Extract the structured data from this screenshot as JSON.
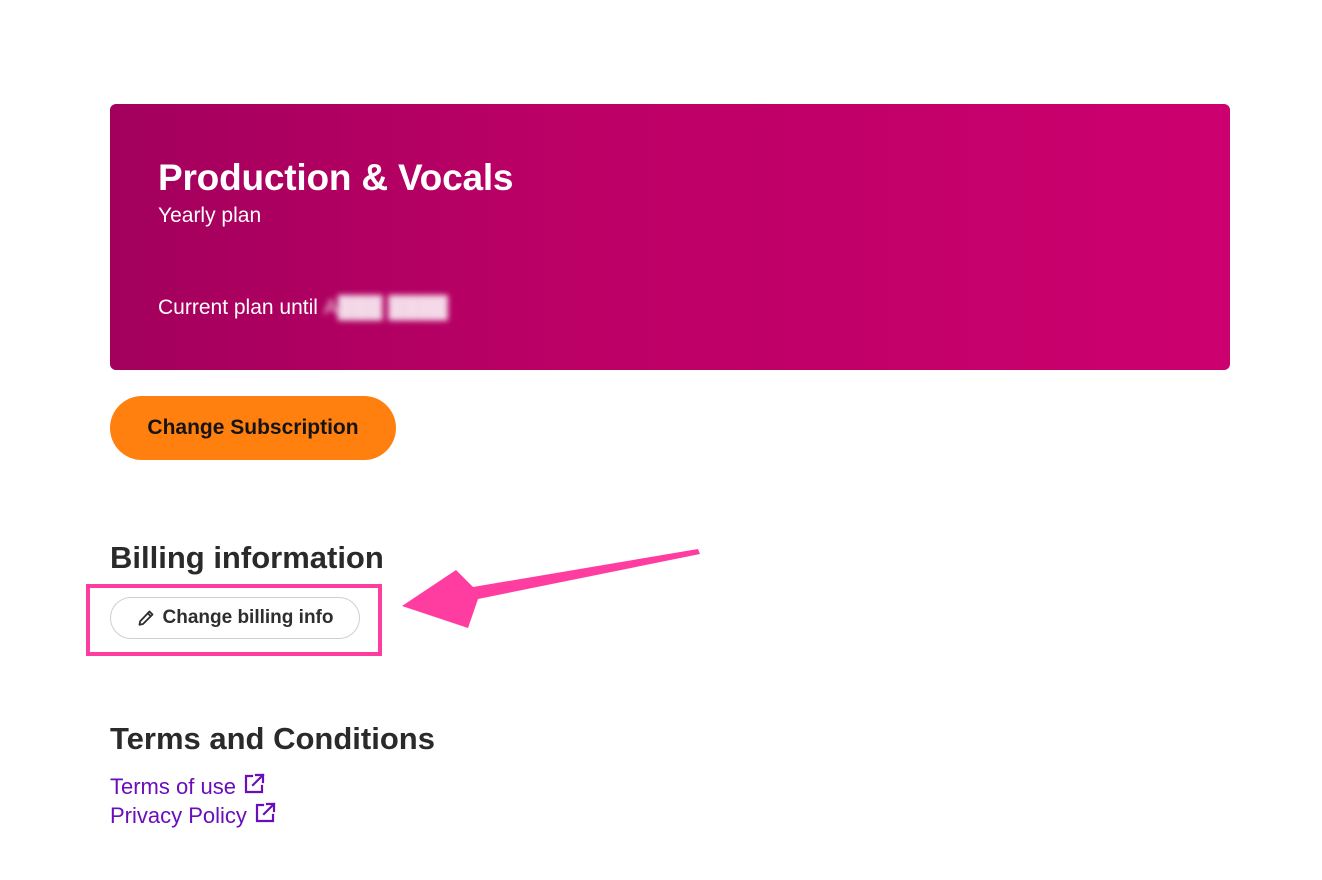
{
  "plan": {
    "title": "Production & Vocals",
    "type": "Yearly plan",
    "until_label": "Current plan until",
    "until_date": "A███ ████"
  },
  "subscription": {
    "change_label": "Change Subscription"
  },
  "billing": {
    "heading": "Billing information",
    "change_label": "Change billing info"
  },
  "terms": {
    "heading": "Terms and Conditions",
    "links": [
      {
        "label": "Terms of use",
        "icon": "external-link-icon"
      },
      {
        "label": "Privacy Policy",
        "icon": "external-link-icon"
      }
    ]
  },
  "colors": {
    "card_gradient_start": "#a3005d",
    "card_gradient_end": "#cc006f",
    "subscription_button": "#ff7f0f",
    "link": "#6a0dbb",
    "annotation": "#ff3da0"
  }
}
